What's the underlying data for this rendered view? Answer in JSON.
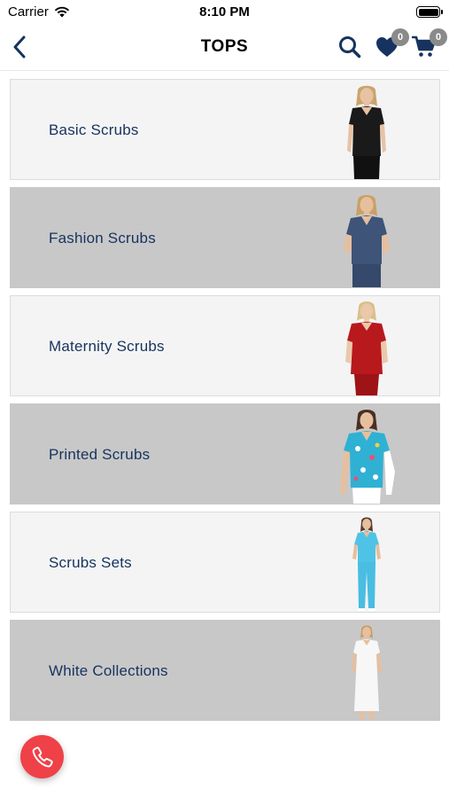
{
  "status_bar": {
    "carrier": "Carrier",
    "time": "8:10 PM"
  },
  "nav": {
    "title": "TOPS",
    "wishlist_count": "0",
    "cart_count": "0"
  },
  "colors": {
    "brand_navy": "#16335f",
    "call_red": "#ef4147",
    "badge_gray": "#8a8a8a"
  },
  "categories": [
    {
      "label": "Basic Scrubs",
      "style": "light",
      "garment": "black top"
    },
    {
      "label": "Fashion Scrubs",
      "style": "dark",
      "garment": "navy set"
    },
    {
      "label": "Maternity Scrubs",
      "style": "light",
      "garment": "red top"
    },
    {
      "label": "Printed Scrubs",
      "style": "dark",
      "garment": "printed blue top"
    },
    {
      "label": "Scrubs Sets",
      "style": "light",
      "garment": "sky blue set"
    },
    {
      "label": "White Collections",
      "style": "dark",
      "garment": "white dress"
    }
  ],
  "icons": [
    "back-chevron-icon",
    "search-icon",
    "heart-icon",
    "cart-icon",
    "phone-icon",
    "wifi-icon",
    "battery-icon"
  ]
}
